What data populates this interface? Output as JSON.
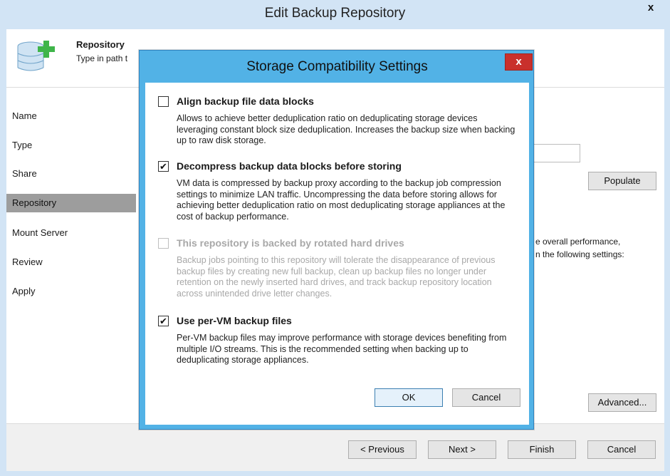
{
  "window": {
    "title": "Edit Backup Repository",
    "close_glyph": "x"
  },
  "header": {
    "title": "Repository",
    "subtitle": "Type in path t",
    "icon": "database-add-icon"
  },
  "sidebar": {
    "items": [
      {
        "label": "Name"
      },
      {
        "label": "Type"
      },
      {
        "label": "Share"
      },
      {
        "label": "Repository"
      },
      {
        "label": "Mount Server"
      },
      {
        "label": "Review"
      },
      {
        "label": "Apply"
      }
    ],
    "active": "Repository"
  },
  "content": {
    "populate_label": "Populate",
    "hint_line1": "e overall performance,",
    "hint_line2": "n the following settings:",
    "advanced_label": "Advanced..."
  },
  "footer": {
    "previous_label": "< Previous",
    "next_label": "Next >",
    "finish_label": "Finish",
    "cancel_label": "Cancel"
  },
  "dialog": {
    "title": "Storage Compatibility Settings",
    "close_glyph": "x",
    "options": [
      {
        "label": "Align backup file data blocks",
        "checked": false,
        "enabled": true,
        "description": "Allows to achieve better deduplication ratio on deduplicating storage devices leveraging constant block size deduplication. Increases the backup size when backing up to raw disk storage."
      },
      {
        "label": "Decompress backup data blocks before storing",
        "checked": true,
        "enabled": true,
        "description": "VM data is compressed by backup proxy according to the backup job compression settings to minimize LAN traffic. Uncompressing the data before storing allows for achieving better deduplication ratio on most deduplicating storage appliances at the cost of backup performance."
      },
      {
        "label": "This repository is backed by rotated hard drives",
        "checked": false,
        "enabled": false,
        "description": "Backup jobs pointing to this repository will tolerate the disappearance of previous backup files by creating new full backup, clean up backup files no longer under retention on the newly inserted hard drives, and track backup repository location across unintended drive letter changes."
      },
      {
        "label": "Use per-VM backup files",
        "checked": true,
        "enabled": true,
        "description": "Per-VM backup files may improve performance with storage devices benefiting from multiple I/O streams. This is the recommended setting when backing up to deduplicating storage appliances."
      }
    ],
    "ok_label": "OK",
    "cancel_label": "Cancel",
    "check_glyph": "✔"
  },
  "colors": {
    "dialog_frame": "#52b2e6",
    "close_button": "#c9302c",
    "sidebar_active": "#9d9d9d"
  }
}
